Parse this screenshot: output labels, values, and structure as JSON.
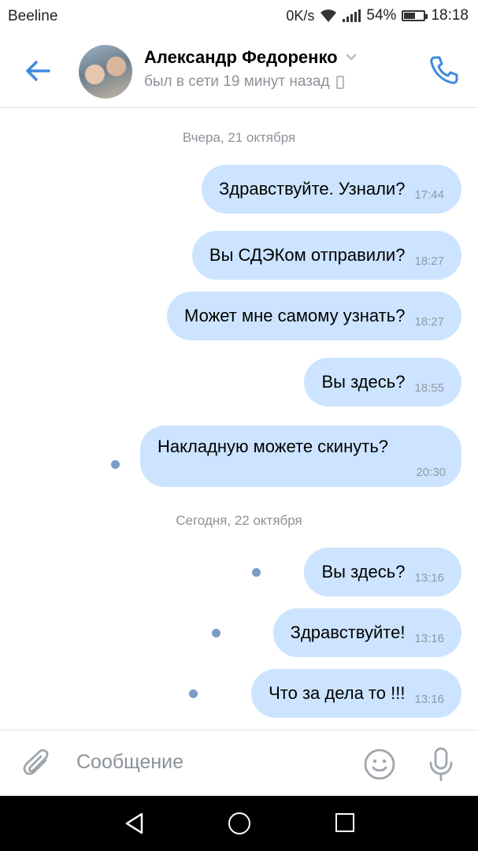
{
  "status_bar": {
    "carrier": "Beeline",
    "speed": "0K/s",
    "battery_percent": "54%",
    "battery_level": 0.54,
    "time": "18:18"
  },
  "header": {
    "contact_name": "Александр Федоренко",
    "status": "был в сети 19 минут назад",
    "accent_color": "#3f8ae0"
  },
  "chat": {
    "date_yesterday": "Вчера, 21 октября",
    "date_today": "Сегодня, 22 октября",
    "bubble_color": "#cce4ff",
    "messages": [
      {
        "text": "Здравствуйте. Узнали?",
        "time": "17:44"
      },
      {
        "text": "Вы СДЭКом отправили?",
        "time": "18:27"
      },
      {
        "text": "Может мне самому узнать?",
        "time": "18:27"
      },
      {
        "text": "Вы здесь?",
        "time": "18:55"
      },
      {
        "text": "Накладную можете скинуть?",
        "time": "20:30"
      },
      {
        "text": "Вы здесь?",
        "time": "13:16"
      },
      {
        "text": "Здравствуйте!",
        "time": "13:16"
      },
      {
        "text": "Что за дела то !!!",
        "time": "13:16"
      }
    ]
  },
  "composer": {
    "placeholder": "Сообщение"
  },
  "icons": {
    "back": "arrow-left-icon",
    "call": "phone-icon",
    "attach": "paperclip-icon",
    "emoji": "smiley-icon",
    "mic": "microphone-icon"
  }
}
